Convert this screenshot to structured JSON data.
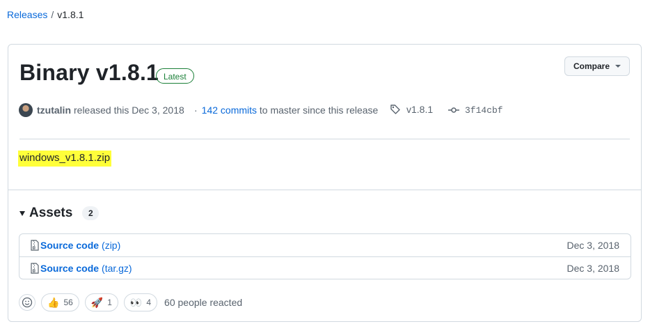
{
  "breadcrumb": {
    "parent": "Releases",
    "separator": "/",
    "current": "v1.8.1"
  },
  "release": {
    "title": "Binary v1.8.1",
    "badge": "Latest",
    "compare_label": "Compare",
    "author": "tzutalin",
    "released_text": "released this Dec 3, 2018",
    "dot": "·",
    "commits_link": "142 commits",
    "commits_suffix": "to master since this release",
    "tag": "v1.8.1",
    "commit_sha": "3f14cbf",
    "body_file": "windows_v1.8.1.zip"
  },
  "assets": {
    "title": "Assets",
    "count": "2",
    "items": [
      {
        "name": "Source code",
        "format": "(zip)",
        "date": "Dec 3, 2018"
      },
      {
        "name": "Source code",
        "format": "(tar.gz)",
        "date": "Dec 3, 2018"
      }
    ]
  },
  "reactions": {
    "items": [
      {
        "emoji": "👍",
        "count": "56"
      },
      {
        "emoji": "🚀",
        "count": "1"
      },
      {
        "emoji": "👀",
        "count": "4"
      }
    ],
    "summary": "60 people reacted"
  },
  "colors": {
    "link": "#0969da",
    "latest": "#1a7f37",
    "highlight": "#ffff3a"
  }
}
